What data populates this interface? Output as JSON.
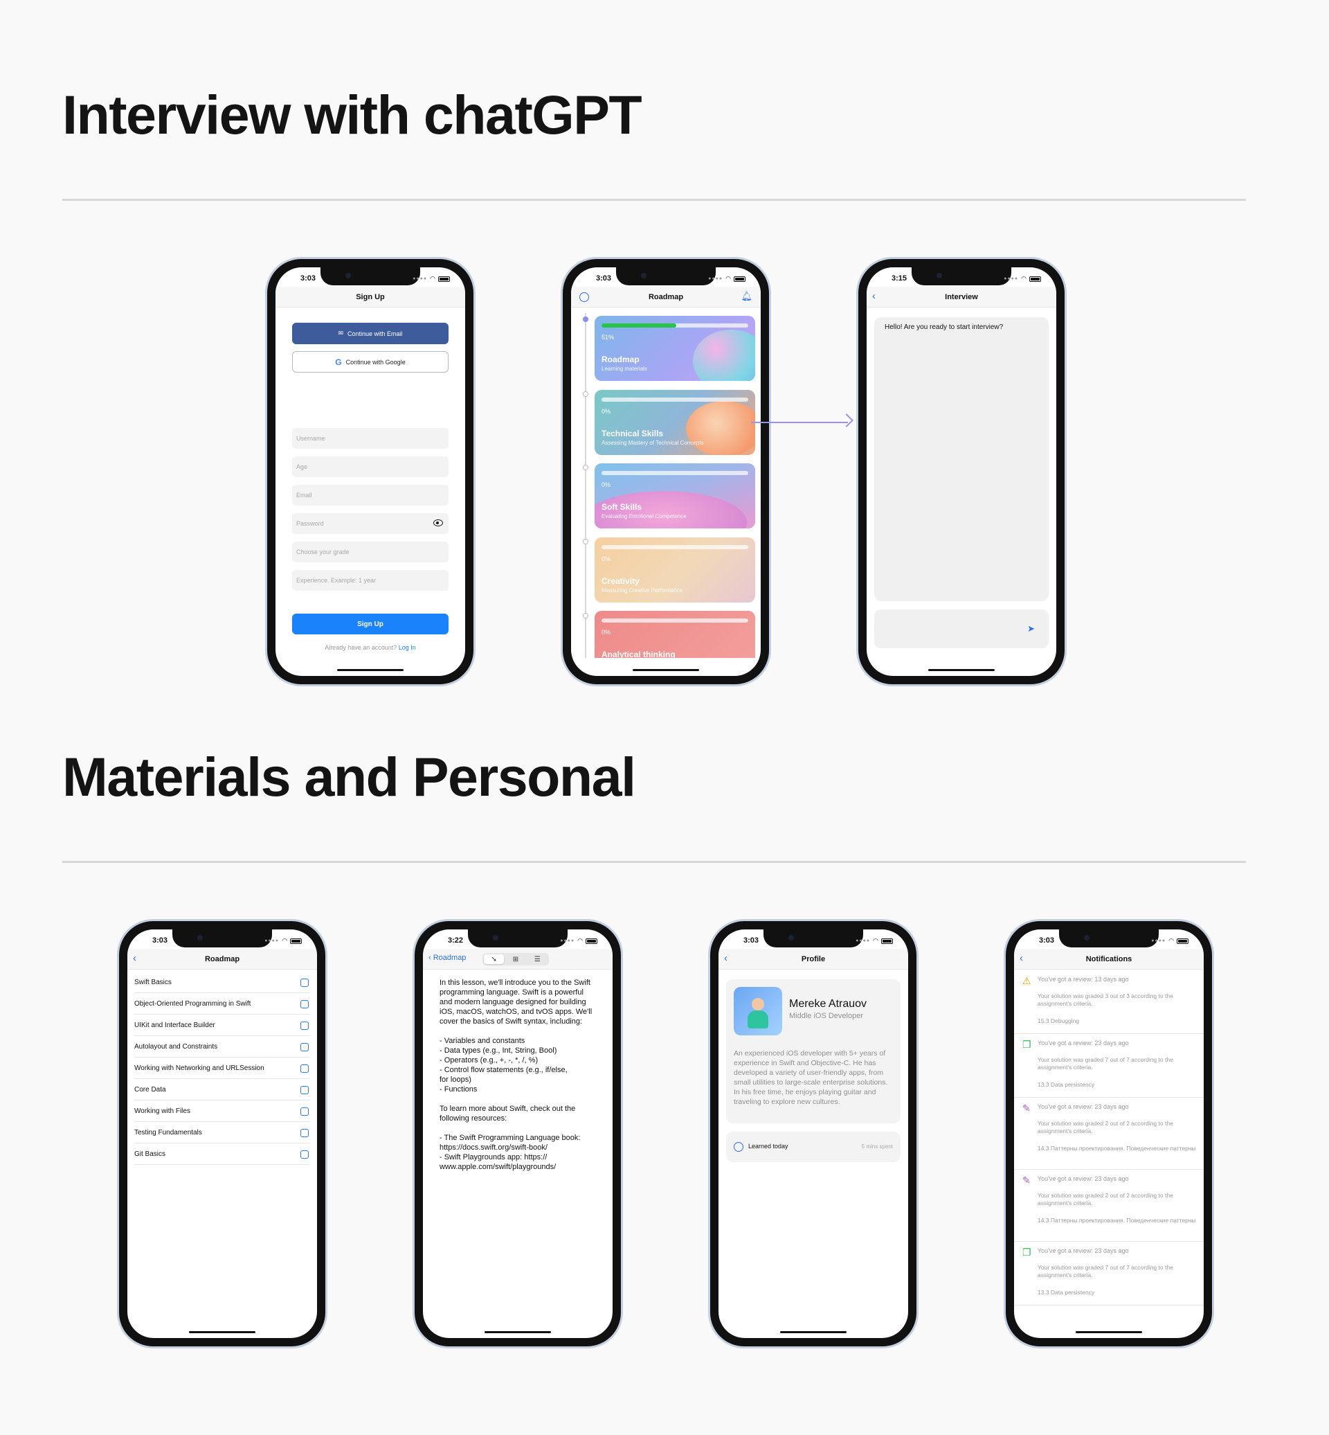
{
  "sections": [
    {
      "title": "Interview with chatGPT"
    },
    {
      "title": "Materials and Personal"
    }
  ],
  "signup": {
    "time": "3:03",
    "title": "Sign Up",
    "email_button": "Continue with Email",
    "google_button": "Continue with Google",
    "fields": [
      "Username",
      "Age",
      "Email",
      "Password",
      "Choose your grade",
      "Experience. Example: 1 year"
    ],
    "submit": "Sign Up",
    "already_text": "Already have an account?",
    "login_link": "Log In"
  },
  "roadmap": {
    "time": "3:03",
    "title": "Roadmap",
    "cards": [
      {
        "pct": "51%",
        "progress": 0.51,
        "title": "Roadmap",
        "subtitle": "Learning materials"
      },
      {
        "pct": "0%",
        "progress": 0,
        "title": "Technical Skills",
        "subtitle": "Assessing Mastery of Technical Concepts"
      },
      {
        "pct": "0%",
        "progress": 0,
        "title": "Soft Skills",
        "subtitle": "Evaluating Emotional Competence"
      },
      {
        "pct": "0%",
        "progress": 0,
        "title": "Creativity",
        "subtitle": "Measuring Creative Performance"
      },
      {
        "pct": "0%",
        "progress": 0,
        "title": "Analytical thinking",
        "subtitle": ""
      }
    ]
  },
  "interview": {
    "time": "3:15",
    "title": "Interview",
    "message": "Hello! Are you ready to start interview?"
  },
  "topics": {
    "time": "3:03",
    "title": "Roadmap",
    "items": [
      "Swift Basics",
      "Object-Oriented Programming in Swift",
      "UIKit and Interface Builder",
      "Autolayout and Constraints",
      "Working with Networking and URLSession",
      "Core Data",
      "Working with Files",
      "Testing Fundamentals",
      "Git Basics"
    ]
  },
  "lesson": {
    "time": "3:22",
    "back": "Roadmap",
    "text": "In this lesson, we'll introduce you to the Swift\nprogramming language. Swift is a powerful\nand modern language designed for building\niOS, macOS, watchOS, and tvOS apps. We'll\ncover the basics of Swift syntax, including:\n\n- Variables and constants\n- Data types (e.g., Int, String, Bool)\n- Operators (e.g., +, -, *, /, %)\n- Control flow statements (e.g., if/else,\nfor loops)\n- Functions\n\nTo learn more about Swift, check out the\nfollowing resources:\n\n- The Swift Programming Language book:\nhttps://docs.swift.org/swift-book/\n- Swift Playgrounds app: https://\nwww.apple.com/swift/playgrounds/"
  },
  "profile": {
    "time": "3:03",
    "title": "Profile",
    "name": "Mereke Atrauov",
    "role": "Middle iOS Developer",
    "bio": "An experienced iOS developer with 5+ years of experience in Swift and Objective-C. He has developed a variety of user-friendly apps, from small utilities to large-scale enterprise solutions. In his free time, he enjoys playing guitar and traveling to explore new cultures.",
    "learned_label": "Learned today",
    "learned_value": "5 mins spent"
  },
  "notifications": {
    "time": "3:03",
    "title": "Notifications",
    "items": [
      {
        "icon": "warning-icon",
        "head": "You've got a review: 13 days ago",
        "body": "Your solution was graded 3 out of 3 according to the assignment's criteria.",
        "course": "15.3 Debugging"
      },
      {
        "icon": "document-icon",
        "head": "You've got a review: 23 days ago",
        "body": "Your solution was graded 7 out of 7 according to the assignment's criteria.",
        "course": "13.3 Data persistency"
      },
      {
        "icon": "brush-icon",
        "head": "You've got a review: 23 days ago",
        "body": "Your solution was graded 2 out of 2 according to the assignment's criteria.",
        "course": "14.3 Паттерны проектирования. Поведенческие паттерны"
      },
      {
        "icon": "brush-icon",
        "head": "You've got a review: 23 days ago",
        "body": "Your solution was graded 2 out of 2 according to the assignment's criteria.",
        "course": "14.3 Паттерны проектирования. Поведенческие паттерны"
      },
      {
        "icon": "document-icon",
        "head": "You've got a review: 23 days ago",
        "body": "Your solution was graded 7 out of 7 according to the assignment's criteria.",
        "course": "13.3 Data persistency"
      }
    ]
  },
  "colors": {
    "accent": "#1a82fa",
    "email_button": "#3e5b9c",
    "arrow": "#9a8ff4"
  }
}
